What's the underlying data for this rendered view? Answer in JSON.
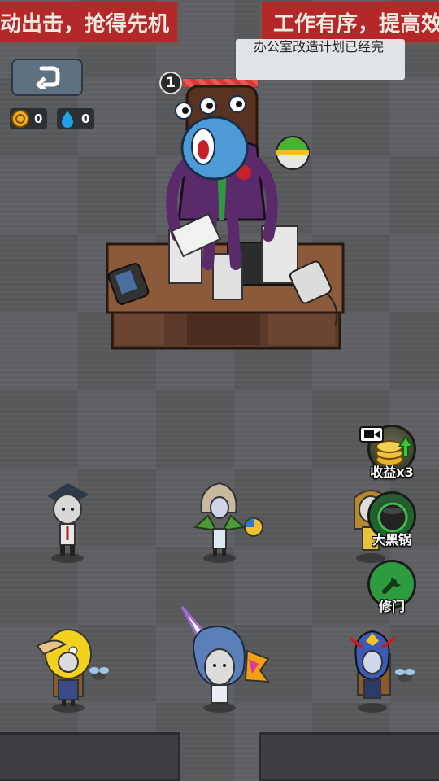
{
  "banners": {
    "left": "动出击，抢得先机",
    "right": "工作有序，提高效"
  },
  "toast": {
    "text": "办公室改造计划已经完"
  },
  "resources": {
    "coins": "0",
    "water": "0"
  },
  "boss": {
    "level": "1"
  },
  "side_buttons": {
    "income": "收益x3",
    "pot": "大黑锅",
    "repair": "修门"
  },
  "colors": {
    "banner": "#b4282a",
    "button_green": "#2d9c3f",
    "back_button": "#5d7181"
  },
  "icons": [
    "back-arrow-icon",
    "coin-icon",
    "water-drop-icon",
    "video-icon",
    "gold-coins-icon",
    "black-pot-icon",
    "wrench-icon"
  ]
}
